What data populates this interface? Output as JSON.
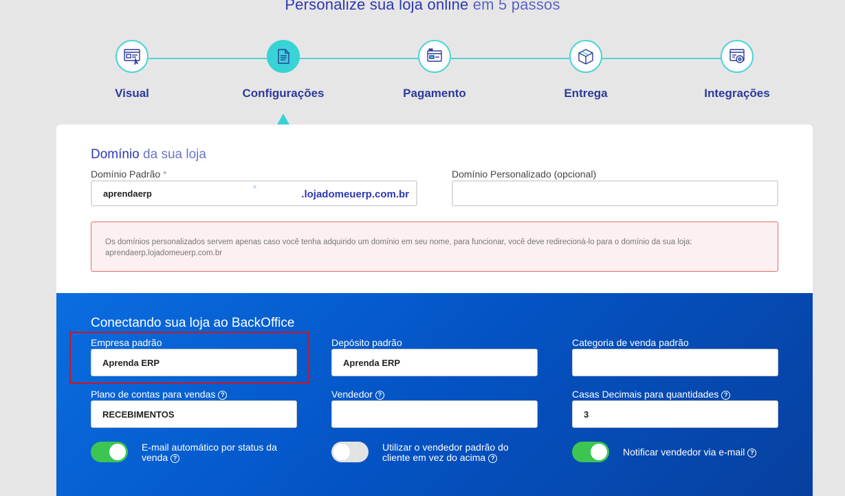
{
  "page_title": {
    "main": "Personalize sua loja online",
    "suffix": "em 5 passos"
  },
  "steps": [
    {
      "label": "Visual",
      "icon": "visual-icon",
      "active": false
    },
    {
      "label": "Configurações",
      "icon": "document-icon",
      "active": true
    },
    {
      "label": "Pagamento",
      "icon": "payment-icon",
      "active": false
    },
    {
      "label": "Entrega",
      "icon": "box-icon",
      "active": false
    },
    {
      "label": "Integrações",
      "icon": "integration-icon",
      "active": false
    }
  ],
  "domain": {
    "title_main": "Domínio",
    "title_rest": "da sua loja",
    "default_label": "Domínio Padrão",
    "required_mark": "*",
    "default_value": "aprendaerp",
    "default_suffix": ".lojadomeuerp.com.br",
    "custom_label": "Domínio Personalizado (opcional)",
    "custom_value": "",
    "alert_line1": "Os domínios personalizados servem apenas caso você tenha adquirido um domínio em seu nome, para funcionar, você deve redirecioná-lo para o domínio da sua loja:",
    "alert_line2": "aprendaerp.lojadomeuerp.com.br"
  },
  "backoffice": {
    "title": "Conectando sua loja ao BackOffice",
    "empresa_label": "Empresa padrão",
    "empresa_value": "Aprenda ERP",
    "deposito_label": "Depósito padrão",
    "deposito_value": "Aprenda ERP",
    "categoria_label": "Categoria de venda padrão",
    "categoria_value": "",
    "plano_label": "Plano de contas para vendas",
    "plano_value": "RECEBIMENTOS",
    "vendedor_label": "Vendedor",
    "vendedor_value": "",
    "casas_label": "Casas Decimais para quantidades",
    "casas_value": "3",
    "help_glyph": "?",
    "toggle_email_line1": "E-mail automático por status da",
    "toggle_email_line2": "venda",
    "toggle_email_on": true,
    "toggle_vendedor_line1": "Utilizar o vendedor padrão do",
    "toggle_vendedor_line2": "cliente em vez do acima",
    "toggle_vendedor_on": false,
    "toggle_notificar_label": "Notificar vendedor via e-mail",
    "toggle_notificar_on": true
  },
  "colors": {
    "accent": "#38d3d6",
    "brand_blue": "#2c37b4",
    "toggle_on": "#3cc553",
    "highlight": "#d0151a"
  }
}
